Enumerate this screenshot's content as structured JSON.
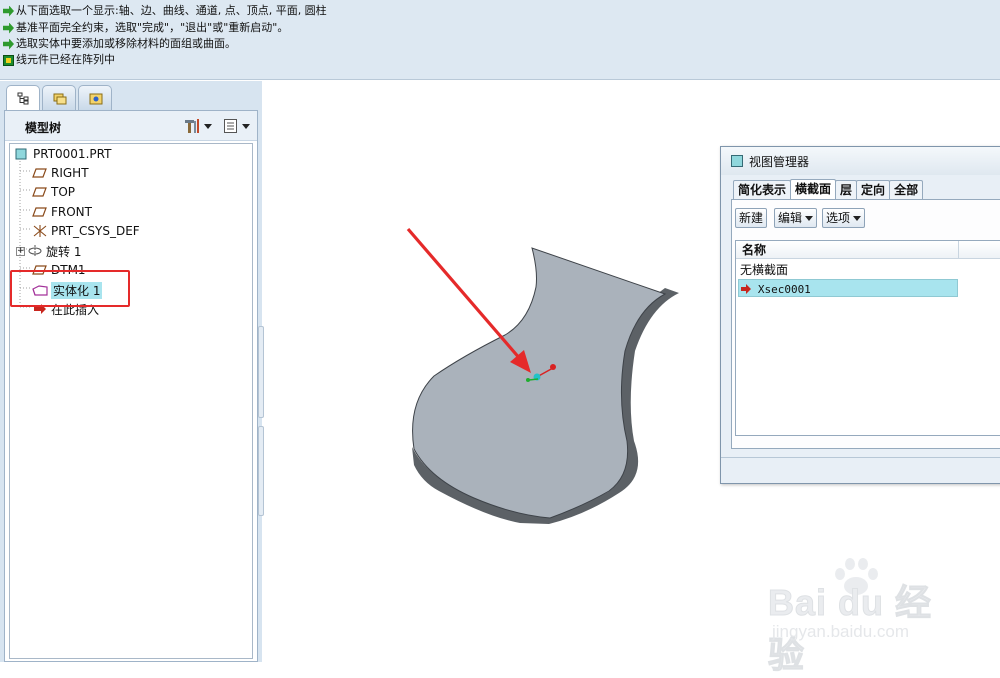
{
  "messages": [
    {
      "icon": "green-arrow-icon",
      "text": "从下面选取一个显示:轴、边、曲线、通道, 点、顶点, 平面, 圆柱"
    },
    {
      "icon": "green-arrow-icon",
      "text": "基准平面完全约束，选取\"完成\"，\"退出\"或\"重新启动\"。"
    },
    {
      "icon": "green-arrow-icon",
      "text": "选取实体中要添加或移除材料的面组或曲面。"
    },
    {
      "icon": "warning-icon",
      "text": "线元件已经在阵列中"
    }
  ],
  "model_tree": {
    "title": "模型树",
    "items": [
      {
        "label": "PRT0001.PRT",
        "icon": "part-icon"
      },
      {
        "label": "RIGHT",
        "icon": "datum-plane-icon"
      },
      {
        "label": "TOP",
        "icon": "datum-plane-icon"
      },
      {
        "label": "FRONT",
        "icon": "datum-plane-icon"
      },
      {
        "label": "PRT_CSYS_DEF",
        "icon": "csys-icon"
      },
      {
        "label": "旋转 1",
        "icon": "revolve-icon"
      },
      {
        "label": "DTM1",
        "icon": "datum-plane-icon"
      },
      {
        "label": "实体化 1",
        "icon": "solidify-icon"
      },
      {
        "label": "在此插入",
        "icon": "insert-here-icon"
      }
    ]
  },
  "view_manager": {
    "title": "视图管理器",
    "tabs": [
      "简化表示",
      "横截面",
      "层",
      "定向",
      "全部"
    ],
    "active_tab": "横截面",
    "buttons": {
      "new": "新建",
      "edit": "编辑",
      "options": "选项"
    },
    "list_header": "名称",
    "rows": [
      "无横截面",
      "Xsec0001"
    ]
  },
  "watermark": {
    "brand": "Bai du 经验",
    "url": "jingyan.baidu.com"
  },
  "colors": {
    "message_bg": "#dde8f2",
    "panel_bg": "#d7e4f0",
    "selection": "#a8e4ee",
    "highlight_red": "#e52a2a",
    "model_face": "#aab2bb",
    "model_side": "#5c6166"
  }
}
